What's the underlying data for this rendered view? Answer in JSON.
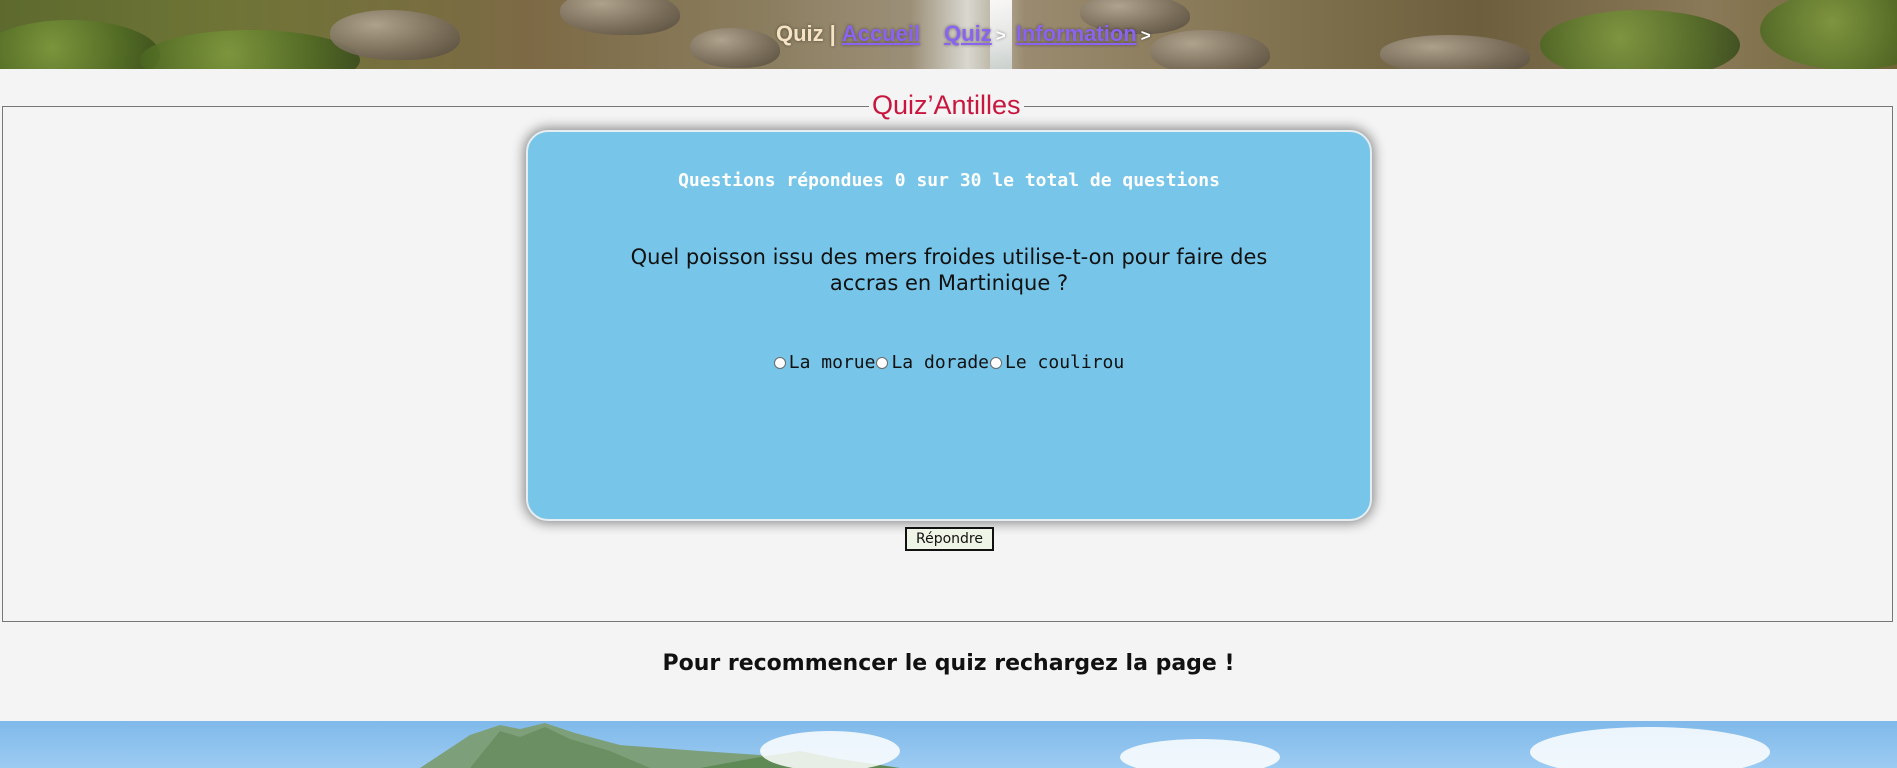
{
  "nav": {
    "brand": "Quiz",
    "separator": "|",
    "links": [
      {
        "label": "Accueil"
      },
      {
        "label": "Quiz"
      },
      {
        "label": "Information"
      }
    ],
    "arrow": ">"
  },
  "quiz": {
    "legend": "Quiz’Antilles",
    "progress": "Questions répondues 0 sur 30 le total de questions",
    "question": "Quel poisson issu des mers froides utilise-t-on pour faire des accras en Martinique ?",
    "choices": [
      {
        "label": "La morue"
      },
      {
        "label": "La dorade"
      },
      {
        "label": "Le coulirou"
      }
    ],
    "submit_label": "Répondre"
  },
  "footer": {
    "restart_message": "Pour recommencer le quiz rechargez la page !"
  },
  "colors": {
    "card_background": "#77c5e8",
    "legend_text": "#c8173f",
    "nav_link": "#8a63f0",
    "page_background": "#f4f4f4"
  }
}
